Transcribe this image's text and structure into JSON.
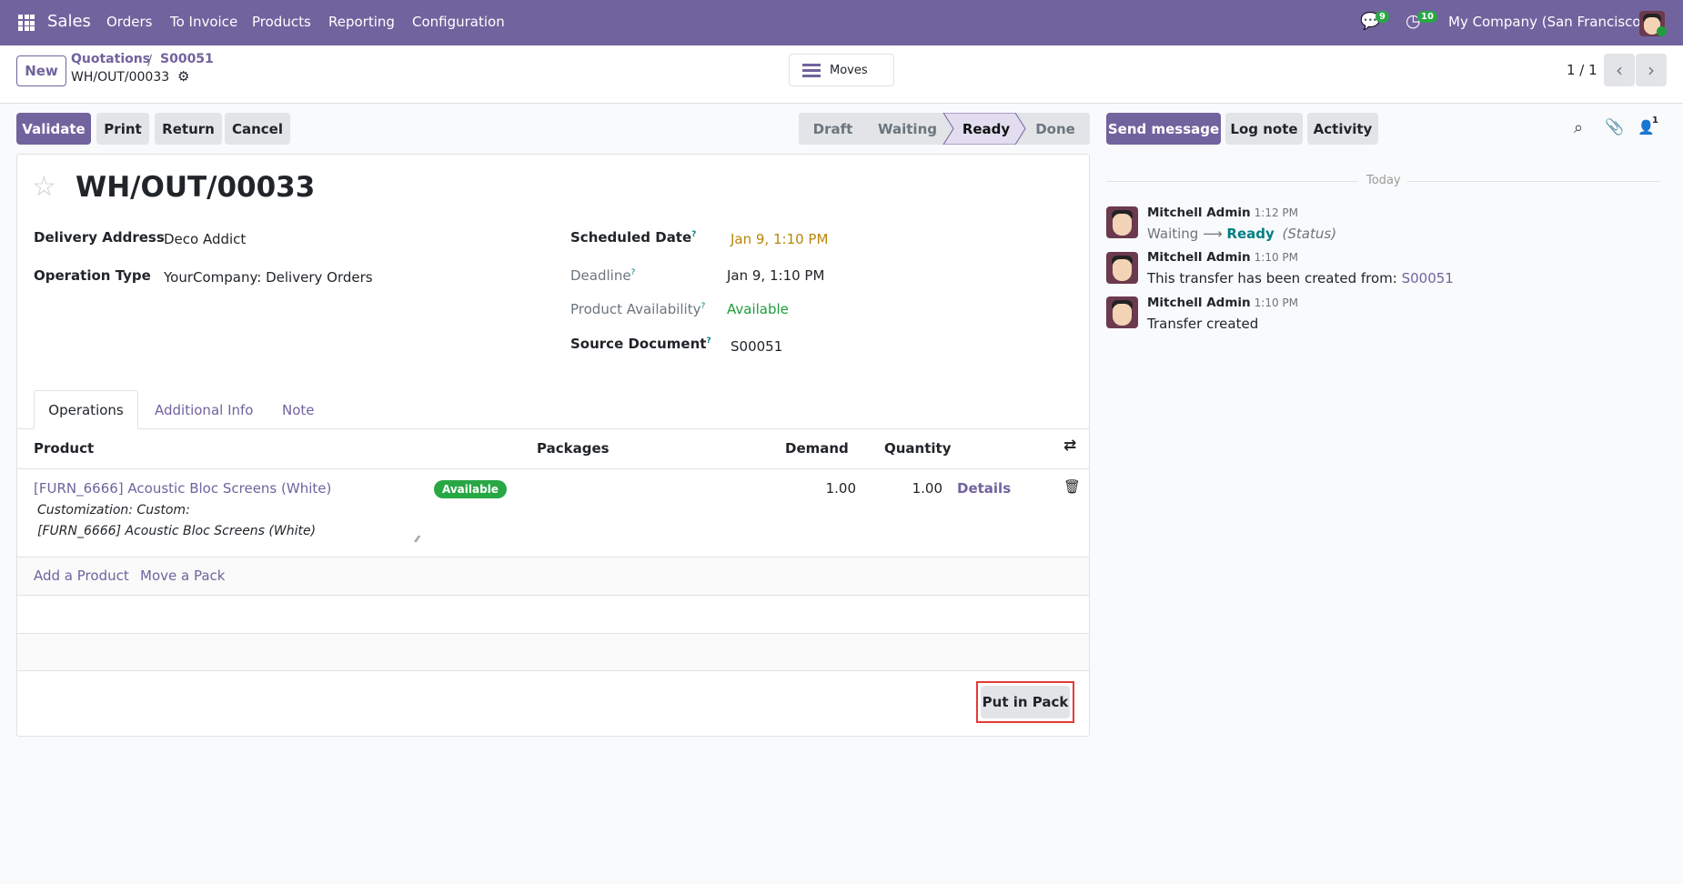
{
  "nav": {
    "app": "Sales",
    "menu": [
      "Orders",
      "To Invoice",
      "Products",
      "Reporting",
      "Configuration"
    ],
    "messages_count": "9",
    "activities_count": "10",
    "company": "My Company (San Francisco)"
  },
  "control": {
    "new": "New",
    "breadcrumb_parent": "Quotations",
    "breadcrumb_sep": "/",
    "breadcrumb_order": "S00051",
    "record": "WH/OUT/00033",
    "moves": "Moves",
    "pager": "1 / 1"
  },
  "actions": {
    "validate": "Validate",
    "print": "Print",
    "return": "Return",
    "cancel": "Cancel"
  },
  "statusbar": [
    "Draft",
    "Waiting",
    "Ready",
    "Done"
  ],
  "status_current": "Ready",
  "form": {
    "title": "WH/OUT/00033",
    "delivery_address_label": "Delivery Address",
    "delivery_address": "Deco Addict",
    "operation_type_label": "Operation Type",
    "operation_type": "YourCompany: Delivery Orders",
    "scheduled_date_label": "Scheduled Date",
    "scheduled_date": "Jan 9, 1:10 PM",
    "deadline_label": "Deadline",
    "deadline": "Jan 9, 1:10 PM",
    "availability_label": "Product Availability",
    "availability": "Available",
    "source_label": "Source Document",
    "source": "S00051",
    "help": "?"
  },
  "tabs": [
    "Operations",
    "Additional Info",
    "Note"
  ],
  "table": {
    "headers": {
      "product": "Product",
      "packages": "Packages",
      "demand": "Demand",
      "quantity": "Quantity"
    },
    "rows": [
      {
        "product": "[FURN_6666] Acoustic Bloc Screens (White)",
        "badge": "Available",
        "desc1": "Customization: Custom:",
        "desc2": "[FURN_6666] Acoustic Bloc Screens (White)",
        "demand": "1.00",
        "quantity": "1.00",
        "details": "Details"
      }
    ],
    "add_product": "Add a Product",
    "move_pack": "Move a Pack",
    "put_in_pack": "Put in Pack"
  },
  "chatter": {
    "send": "Send message",
    "log": "Log note",
    "activity": "Activity",
    "followers": "1",
    "today": "Today",
    "messages": [
      {
        "author": "Mitchell Admin",
        "time": "1:12 PM",
        "from": "Waiting",
        "arrow": "⟶",
        "to": "Ready",
        "field": "(Status)"
      },
      {
        "author": "Mitchell Admin",
        "time": "1:10 PM",
        "text": "This transfer has been created from: ",
        "link": "S00051"
      },
      {
        "author": "Mitchell Admin",
        "time": "1:10 PM",
        "text": "Transfer created"
      }
    ]
  },
  "colors": {
    "brand": "#71639e",
    "success": "#28a745",
    "warning": "#b8860b",
    "info": "#017e84"
  }
}
